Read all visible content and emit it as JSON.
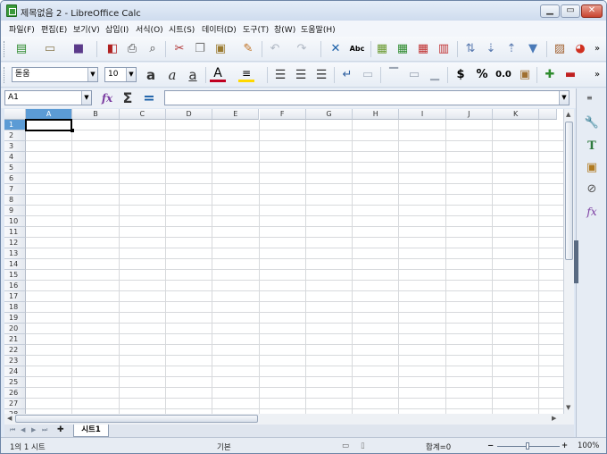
{
  "window": {
    "title": "제목없음 2 - LibreOffice Calc"
  },
  "menu": [
    "파일(F)",
    "편집(E)",
    "보기(V)",
    "삽입(I)",
    "서식(O)",
    "시트(S)",
    "데이터(D)",
    "도구(T)",
    "창(W)",
    "도움말(H)"
  ],
  "format": {
    "font_name": "돋움",
    "font_size": "10"
  },
  "formula": {
    "name_box": "A1",
    "sum_symbol": "Σ",
    "equals_symbol": "=",
    "fx_label": "fx",
    "content": ""
  },
  "columns": [
    "A",
    "B",
    "C",
    "D",
    "E",
    "F",
    "G",
    "H",
    "I",
    "J",
    "K"
  ],
  "rows": [
    "1",
    "2",
    "3",
    "4",
    "5",
    "6",
    "7",
    "8",
    "9",
    "10",
    "11",
    "12",
    "13",
    "14",
    "15",
    "16",
    "17",
    "18",
    "19",
    "20",
    "21",
    "22",
    "23",
    "24",
    "25",
    "26",
    "27",
    "28"
  ],
  "toolbar_text": {
    "currency": "$",
    "percent": "%",
    "number": "0.0",
    "spellcheck": "Abc",
    "bold": "a",
    "italic": "a",
    "underline": "a",
    "font_color": "A",
    "more": "»"
  },
  "sheet": {
    "tab_label": "시트1",
    "add_tab": "✚"
  },
  "status": {
    "sheet_position": "1의 1 시트",
    "page_style": "기본",
    "sum": "합계=0",
    "zoom": "100%",
    "zoom_minus": "−",
    "zoom_plus": "+"
  },
  "colors": {
    "selection": "#c6d9f1",
    "header_active": "#5b9bd5",
    "title_grad": "#cfdcee"
  }
}
